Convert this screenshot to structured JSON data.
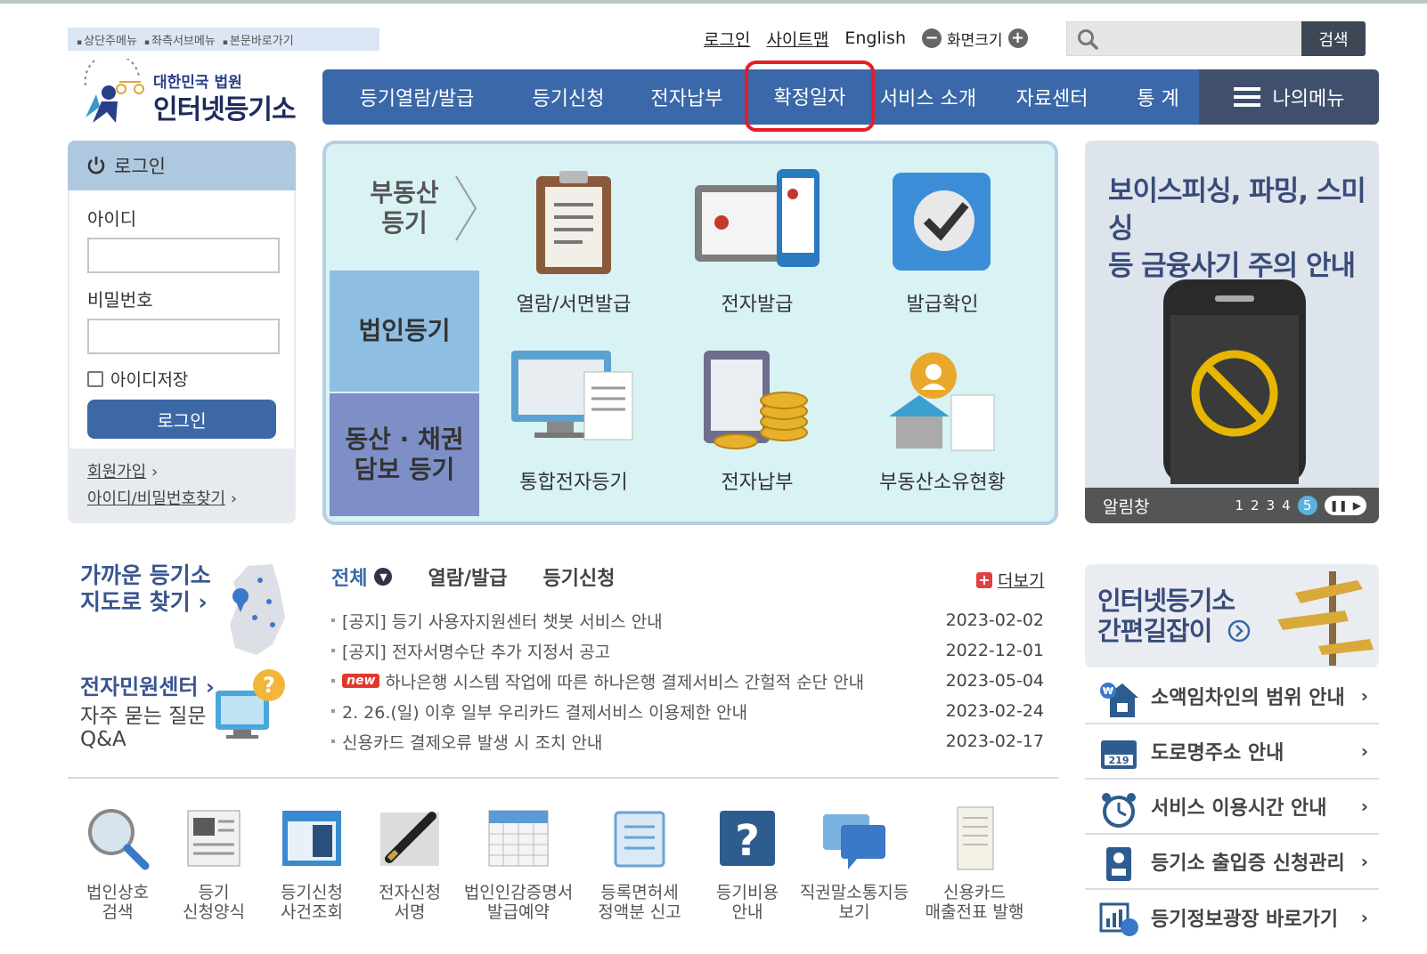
{
  "skip_links": [
    "상단주메뉴",
    "좌측서브메뉴",
    "본문바로가기"
  ],
  "util": {
    "login": "로그인",
    "sitemap": "사이트맵",
    "english": "English",
    "zoom": "화면크기"
  },
  "search": {
    "button": "검색",
    "placeholder": ""
  },
  "logo": {
    "line1": "대한민국 법원",
    "line2": "인터넷등기소"
  },
  "gnb": {
    "items": [
      "등기열람/발급",
      "등기신청",
      "전자납부",
      "확정일자",
      "서비스 소개",
      "자료센터",
      "통 계"
    ],
    "mymenu": "나의메뉴",
    "highlighted": "확정일자"
  },
  "login_box": {
    "title": "로그인",
    "id_label": "아이디",
    "pw_label": "비밀번호",
    "save_id": "아이디저장",
    "button": "로그인",
    "join": "회원가입",
    "find": "아이디/비밀번호찾기"
  },
  "service": {
    "tabs": [
      "부동산\n등기",
      "법인등기",
      "동산 · 채권\n담보 등기"
    ],
    "items": [
      "열람/서면발급",
      "전자발급",
      "발급확인",
      "통합전자등기",
      "전자납부",
      "부동산소유현황"
    ]
  },
  "banner": {
    "title": "보이스피싱, 파밍, 스미싱\n등 금융사기 주의 안내",
    "bar": "알림창",
    "pages": [
      "1",
      "2",
      "3",
      "4",
      "5"
    ],
    "active_page": "5"
  },
  "side": {
    "near_title": "가까운 등기소\n지도로 찾기 ›",
    "epc": "전자민원센터 ›",
    "faq": "자주 묻는 질문\nQ&A"
  },
  "news": {
    "tabs": [
      "전체",
      "열람/발급",
      "등기신청"
    ],
    "more": "더보기",
    "new_tag": "new",
    "rows": [
      {
        "title": "[공지] 등기 사용자지원센터 챗봇 서비스 안내",
        "date": "2023-02-02",
        "new": false
      },
      {
        "title": "[공지] 전자서명수단 추가 지정서 공고",
        "date": "2022-12-01",
        "new": false
      },
      {
        "title": "하나은행 시스템 작업에 따른 하나은행 결제서비스 간헐적 순단 안내",
        "date": "2023-05-04",
        "new": true
      },
      {
        "title": "2. 26.(일) 이후 일부 우리카드 결제서비스 이용제한 안내",
        "date": "2023-02-24",
        "new": false
      },
      {
        "title": "신용카드 결제오류 발생 시 조치 안내",
        "date": "2023-02-17",
        "new": false
      }
    ]
  },
  "quick": [
    {
      "l1": "법인상호",
      "l2": "검색"
    },
    {
      "l1": "등기",
      "l2": "신청양식"
    },
    {
      "l1": "등기신청",
      "l2": "사건조회"
    },
    {
      "l1": "전자신청",
      "l2": "서명"
    },
    {
      "l1": "법인인감증명서",
      "l2": "발급예약"
    },
    {
      "l1": "등록면허세",
      "l2": "정액분 신고"
    },
    {
      "l1": "등기비용",
      "l2": "안내"
    },
    {
      "l1": "직권말소통지등",
      "l2": "보기"
    },
    {
      "l1": "신용카드",
      "l2": "매출전표 발행"
    }
  ],
  "guide": {
    "title": "인터넷등기소\n간편길잡이"
  },
  "links": [
    "소액임차인의 범위 안내",
    "도로명주소 안내",
    "서비스 이용시간 안내",
    "등기소 출입증 신청관리",
    "등기정보광장 바로가기"
  ]
}
